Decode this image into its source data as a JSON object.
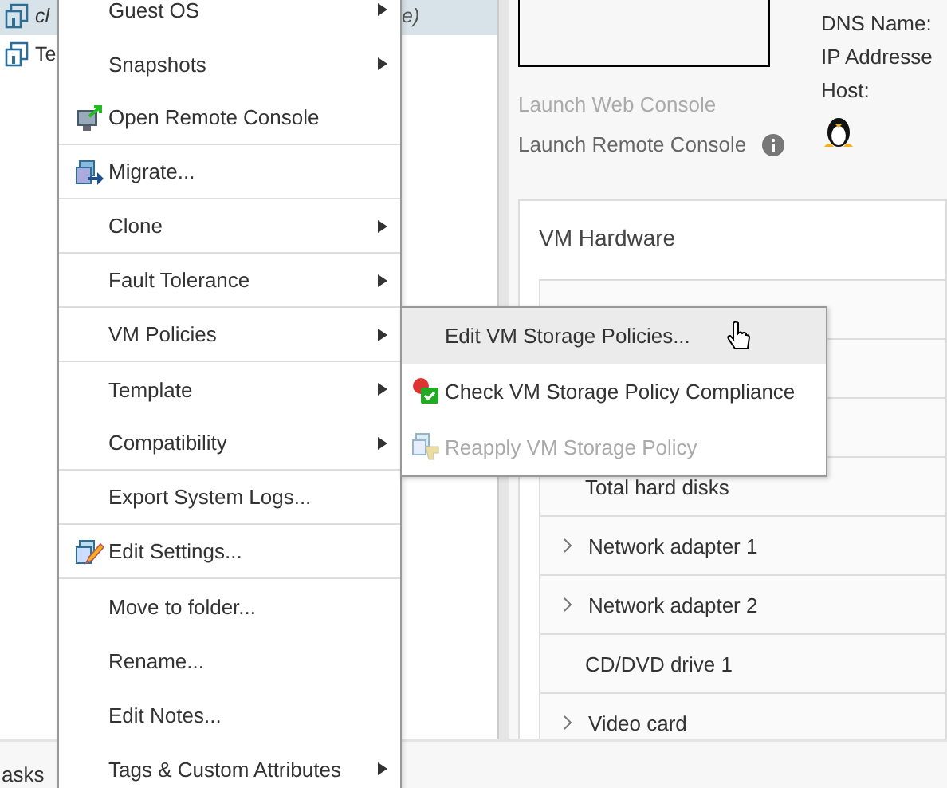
{
  "tree": {
    "items": [
      {
        "label": "cl",
        "tail": "e)",
        "selected": true
      },
      {
        "label": "Te",
        "selected": false
      }
    ]
  },
  "console": {
    "launch_web": "Launch Web Console",
    "launch_remote": "Launch Remote Console"
  },
  "summary": {
    "labels": [
      "DNS Name:",
      "IP Addresse",
      "Host:"
    ]
  },
  "hardware": {
    "title": "VM Hardware",
    "rows": [
      {
        "label": "Total hard disks",
        "expandable": false
      },
      {
        "label": "Network adapter 1",
        "expandable": true
      },
      {
        "label": "Network adapter 2",
        "expandable": true
      },
      {
        "label": "CD/DVD drive 1",
        "expandable": false
      },
      {
        "label": "Video card",
        "expandable": true
      }
    ]
  },
  "context_menu": {
    "items": [
      {
        "label": "Guest OS",
        "kind": "plain",
        "submenu": true,
        "divider_after": false
      },
      {
        "label": "Snapshots",
        "kind": "plain",
        "submenu": true,
        "divider_after": false
      },
      {
        "label": "Open Remote Console",
        "kind": "console",
        "submenu": false,
        "divider_after": true
      },
      {
        "label": "Migrate...",
        "kind": "migrate",
        "submenu": false,
        "divider_after": true
      },
      {
        "label": "Clone",
        "kind": "plain",
        "submenu": true,
        "divider_after": true
      },
      {
        "label": "Fault Tolerance",
        "kind": "plain",
        "submenu": true,
        "divider_after": true
      },
      {
        "label": "VM Policies",
        "kind": "plain",
        "submenu": true,
        "divider_after": true
      },
      {
        "label": "Template",
        "kind": "plain",
        "submenu": true,
        "divider_after": false
      },
      {
        "label": "Compatibility",
        "kind": "plain",
        "submenu": true,
        "divider_after": true
      },
      {
        "label": "Export System Logs...",
        "kind": "plain",
        "submenu": false,
        "divider_after": true
      },
      {
        "label": "Edit Settings...",
        "kind": "settings",
        "submenu": false,
        "divider_after": true
      },
      {
        "label": "Move to folder...",
        "kind": "plain",
        "submenu": false,
        "divider_after": false
      },
      {
        "label": "Rename...",
        "kind": "plain",
        "submenu": false,
        "divider_after": false
      },
      {
        "label": "Edit Notes...",
        "kind": "plain",
        "submenu": false,
        "divider_after": false
      },
      {
        "label": "Tags & Custom Attributes",
        "kind": "plain",
        "submenu": true,
        "divider_after": false
      }
    ]
  },
  "submenu": {
    "items": [
      {
        "label": "Edit VM Storage Policies...",
        "kind": "plain",
        "selected": true,
        "disabled": false
      },
      {
        "label": "Check VM Storage Policy Compliance",
        "kind": "check",
        "selected": false,
        "disabled": false
      },
      {
        "label": "Reapply VM Storage Policy",
        "kind": "reapply",
        "selected": false,
        "disabled": true
      }
    ]
  },
  "bottom_bar": {
    "label": "asks"
  }
}
